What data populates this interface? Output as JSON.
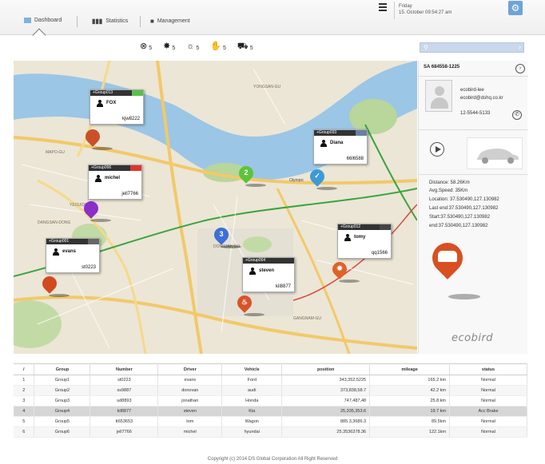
{
  "nav": {
    "tabs": [
      {
        "label": "Dashboard",
        "icon": "dashboard-icon"
      },
      {
        "label": "Statistics",
        "icon": "bar-chart-icon"
      },
      {
        "label": "Management",
        "icon": "person-icon"
      }
    ]
  },
  "header": {
    "day": "Friday",
    "datetime": "15. October 09:54:27 am",
    "menu_icon": "hamburger-icon",
    "settings_icon": "gear-icon"
  },
  "status_counts": [
    {
      "icon": "stop-circle-icon",
      "count": "5"
    },
    {
      "icon": "burst-icon",
      "count": "5"
    },
    {
      "icon": "sun-icon",
      "count": "5"
    },
    {
      "icon": "hand-icon",
      "count": "5"
    },
    {
      "icon": "car-crash-icon",
      "count": "5"
    }
  ],
  "map": {
    "labels": {
      "mapo": "MAPO-GU",
      "yongsan": "YONGSAN-GU",
      "olympic": "Olympic",
      "dongjak": "DONGJAK-GU",
      "gangnam": "GANGNAM-GU",
      "yeouido": "YEOUIDO",
      "dangsan": "DANGSAN-DONG"
    },
    "groups": [
      {
        "group": "+Group013",
        "name": "FOX",
        "code": "kjw8222",
        "color": "#58c04a"
      },
      {
        "group": "+Group006",
        "name": "michel",
        "code": "jell7766",
        "color": "#e0362c"
      },
      {
        "group": "+Group033",
        "name": "Diana",
        "code": "66l6588",
        "color": "#6a7fa0"
      },
      {
        "group": "+Group001",
        "name": "evans",
        "code": "st0223",
        "color": "#666666"
      },
      {
        "group": "+Group012",
        "name": "tomy",
        "code": "qq1566",
        "color": "#444444"
      },
      {
        "group": "+Group004",
        "name": "steven",
        "code": "kil8877",
        "color": "#333333"
      }
    ],
    "pin_numbers": [
      "2",
      "3"
    ]
  },
  "panel": {
    "vehicle_id": "SA 684558-1225",
    "user": "ecobird-lee",
    "email": "ecobird@dshq.co.kr",
    "phone": "12-5544-5133",
    "distance": "Distance: 58.26Km",
    "avg_speed": "Avg.Speed: 35Km",
    "location": "Location: 37.530490,127.130982",
    "last_end": "Last end:37.530490,127.130982",
    "start": "Start:37.530490,127.130982",
    "end": "end:37.530490,127.130982",
    "logo": "ecobird"
  },
  "table": {
    "headers": [
      "/",
      "Group",
      "Number",
      "Driver",
      "Vehicle",
      "position",
      "mileage",
      "status"
    ],
    "rows": [
      [
        "1",
        "Group1",
        "st0223",
        "evans",
        "Ford",
        "343,352,5225",
        "165.2 km",
        "Normal"
      ],
      [
        "2",
        "Group2",
        "ss9887",
        "donovan",
        "audi",
        "373,838,58.7",
        "42.2 km",
        "Normal"
      ],
      [
        "3",
        "Group3",
        "ud8893",
        "jonathan",
        "Honda",
        "747,487,48",
        "25.8 km",
        "Normal"
      ],
      [
        "4",
        "Group4",
        "kil8877",
        "steven",
        "Kia",
        "25,335,353.6",
        "19.7 km",
        "Acc Brake"
      ],
      [
        "5",
        "Group5",
        "tt653653",
        "tom",
        "Wagon",
        "885.3,3686.3",
        "89.5km",
        "Normal"
      ],
      [
        "6",
        "Group6",
        "jell7766",
        "michel",
        "hyundai",
        "25.3536378.36",
        "122.1km",
        "Normal"
      ]
    ]
  },
  "footer": "Copyright (c) 2014 DS Global Corporation All Right Reserved"
}
